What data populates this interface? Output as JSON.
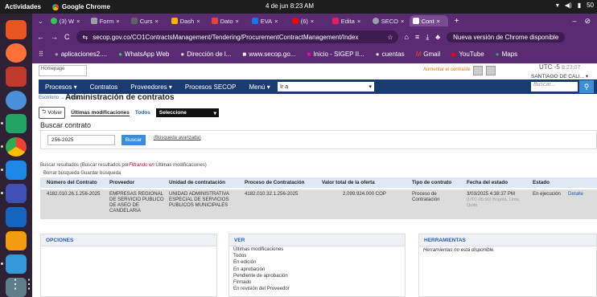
{
  "system": {
    "activities": "Actividades",
    "app": "Google Chrome",
    "clock": "4 de jun  8:23 AM",
    "battery": "50"
  },
  "tabs": [
    {
      "label": "(3) W",
      "color": "#34c759"
    },
    {
      "label": "Form",
      "color": "#9aa0a6"
    },
    {
      "label": "Curs",
      "color": "#5f6368"
    },
    {
      "label": "Dash",
      "color": "#f4b400"
    },
    {
      "label": "Dato",
      "color": "#ea4335"
    },
    {
      "label": "EVA",
      "color": "#1a73e8"
    },
    {
      "label": "(6)",
      "color": "#ff0000"
    },
    {
      "label": "Edita",
      "color": "#e91e63"
    },
    {
      "label": "SECO",
      "color": "#9aa0a6"
    },
    {
      "label": "Cont",
      "color": "#ffffff"
    }
  ],
  "address": {
    "url": "secop.gov.co/CO1ContractsManagement/Tendering/ProcurementContractManagement/Index",
    "new_version": "Nueva versión de Chrome disponible"
  },
  "bookmarks": [
    "aplicaciones2....",
    "WhatsApp Web",
    "Dirección de l...",
    "www.secop.go...",
    "Inicio - SIGEP II...",
    "cuentas",
    "Gmail",
    "YouTube",
    "Maps"
  ],
  "header": {
    "homepage": "Homepage",
    "aumentar": "Aumentar el contraste",
    "utc": "UTC -5",
    "utc_time": "8:23:07",
    "user": "SANTIAGO DE CALI..."
  },
  "nav": {
    "items": [
      "Procesos",
      "Contratos",
      "Proveedores",
      "Procesos SECOP",
      "Menú"
    ],
    "ira": "Ir a",
    "search_placeholder": "Buscar..."
  },
  "breadcrumb": "Escritorio → Menú →",
  "page_title": "Administración de contratos",
  "toolbar": {
    "volver": "Volver",
    "ultimas": "Últimas modificaciones",
    "todos": "Todos",
    "seleccione": "Seleccione"
  },
  "search": {
    "title": "Buscar contrato",
    "value": "256-2025",
    "button": "Buscar",
    "advanced": "(Búsqueda avanzada)"
  },
  "results": {
    "title_prefix": "Buscar resultados (Buscar resultados por",
    "filter_word": "Filtrando en:",
    "title_suffix": "Últimas modificaciones)",
    "clear": "Borrar búsqueda",
    "save": "Guardar búsqueda"
  },
  "table": {
    "headers": [
      "Número del Contrato",
      "Proveedor",
      "Unidad de contratación",
      "Proceso de Contratación",
      "Valor total de la oferta",
      "Tipo de contrato",
      "Fecha del estado",
      "Estado"
    ],
    "row": {
      "numero": "4182.010.26.1.256-2025",
      "proveedor": "EMPRESAS REGIONAL DE SERVICIO PUBLICO DE ASEO DE CANDELARIA",
      "unidad": "UNIDAD ADMINISTRATIVA ESPECIAL DE SERVICIOS PUBLICOS MUNICIPALES",
      "proceso": "4182.010.32.1.256-2025",
      "valor": "2.099.924.000 COP",
      "tipo": "Proceso de Contratación",
      "fecha": "3/03/2025 4:38:37 PM",
      "fecha_tz": "(UTC-05:00) Bogotá, Lima, Quito",
      "estado": "En ejecución",
      "detalle": "Detalle"
    }
  },
  "panels": {
    "opciones": "OPCIONES",
    "ver": "VER",
    "ver_items": [
      "Últimas modificaciones",
      "Todos",
      "En edición",
      "En aprobación",
      "Pendiente de aprobación",
      "Firmado",
      "En revisión del Proveedor"
    ],
    "herramientas": "HERRAMIENTAS",
    "herramientas_msg": "Herramientas no está disponible."
  }
}
